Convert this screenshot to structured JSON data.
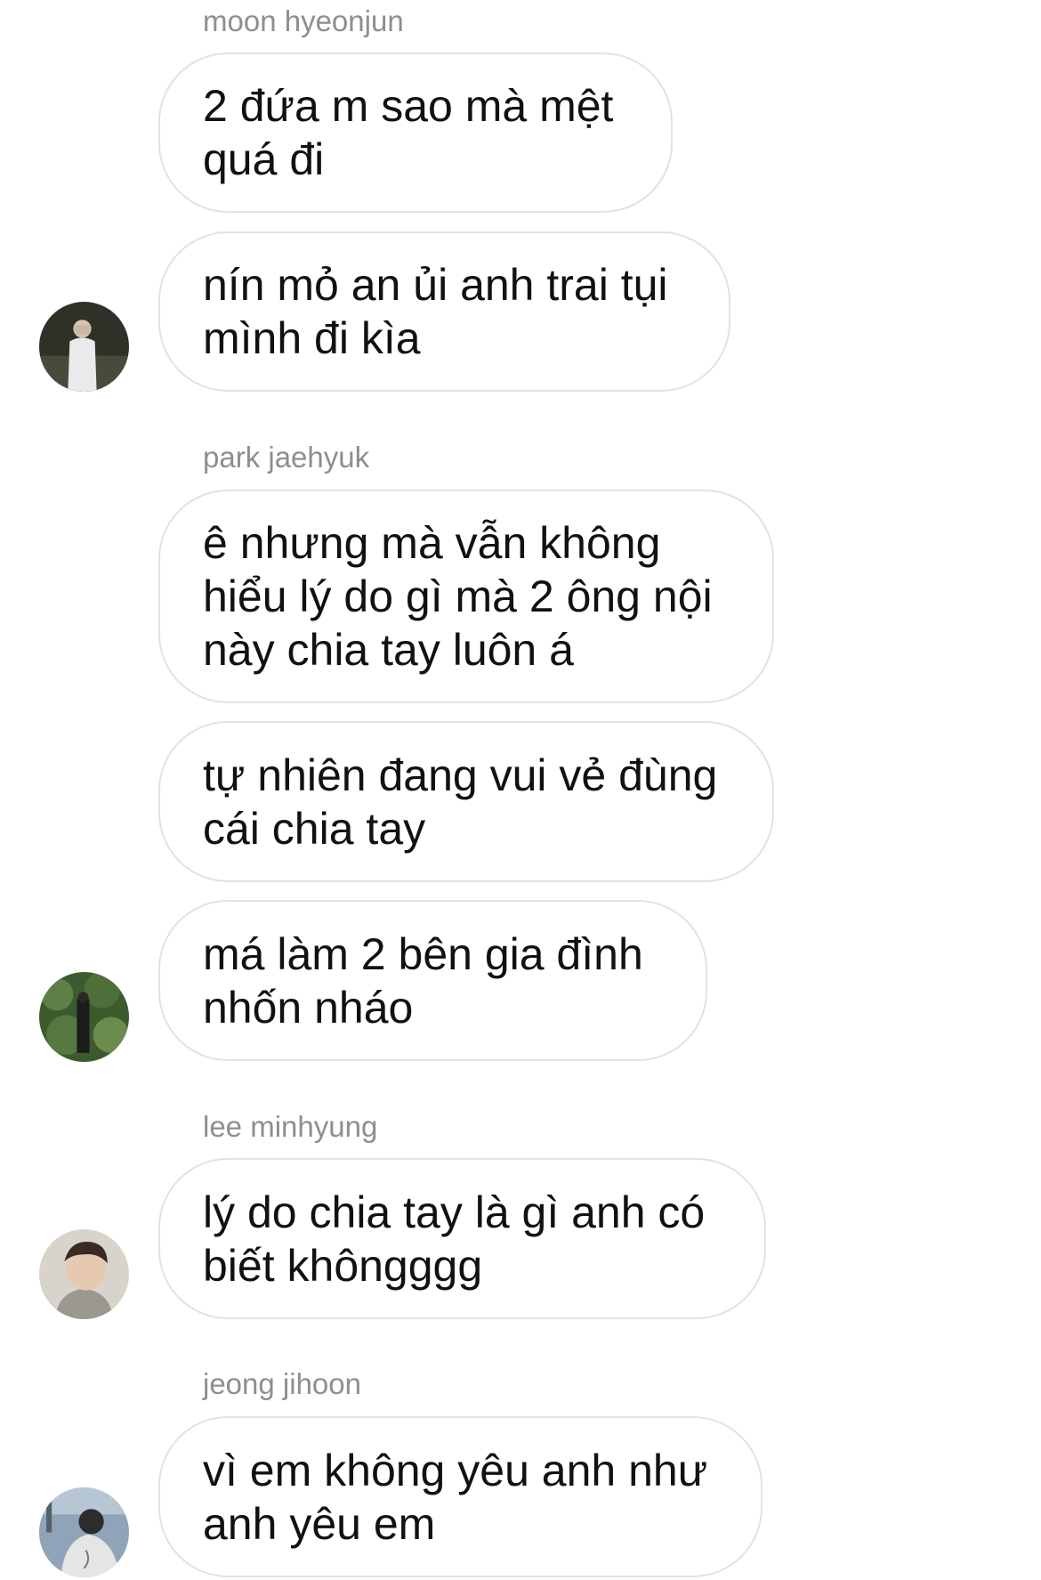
{
  "chat": {
    "groups": [
      {
        "sender": "moon hyeonjun",
        "messages": [
          "2 đứa m sao mà mệt\nquá đi",
          "nín mỏ an ủi anh trai tụi\nmình đi kìa"
        ],
        "avatar_icon": "profile-photo-icon"
      },
      {
        "sender": "park jaehyuk",
        "messages": [
          "ê nhưng mà vẫn không\nhiểu lý do gì mà 2 ông nội\nnày chia tay luôn á",
          "tự nhiên đang vui vẻ đùng\ncái chia tay",
          "má làm 2 bên gia đình\nnhốn nháo"
        ],
        "avatar_icon": "profile-photo-icon"
      },
      {
        "sender": "lee minhyung",
        "messages": [
          "lý do chia tay là gì anh có\nbiết khôngggg"
        ],
        "avatar_icon": "profile-photo-icon"
      },
      {
        "sender": "jeong jihoon",
        "messages": [
          "vì em không yêu anh như\nanh yêu em"
        ],
        "avatar_icon": "profile-photo-icon"
      }
    ]
  },
  "colors": {
    "background": "#ffffff",
    "bubble_border": "#e2e2e2",
    "message_text": "#111111",
    "sender_text": "#8e8e8e"
  }
}
